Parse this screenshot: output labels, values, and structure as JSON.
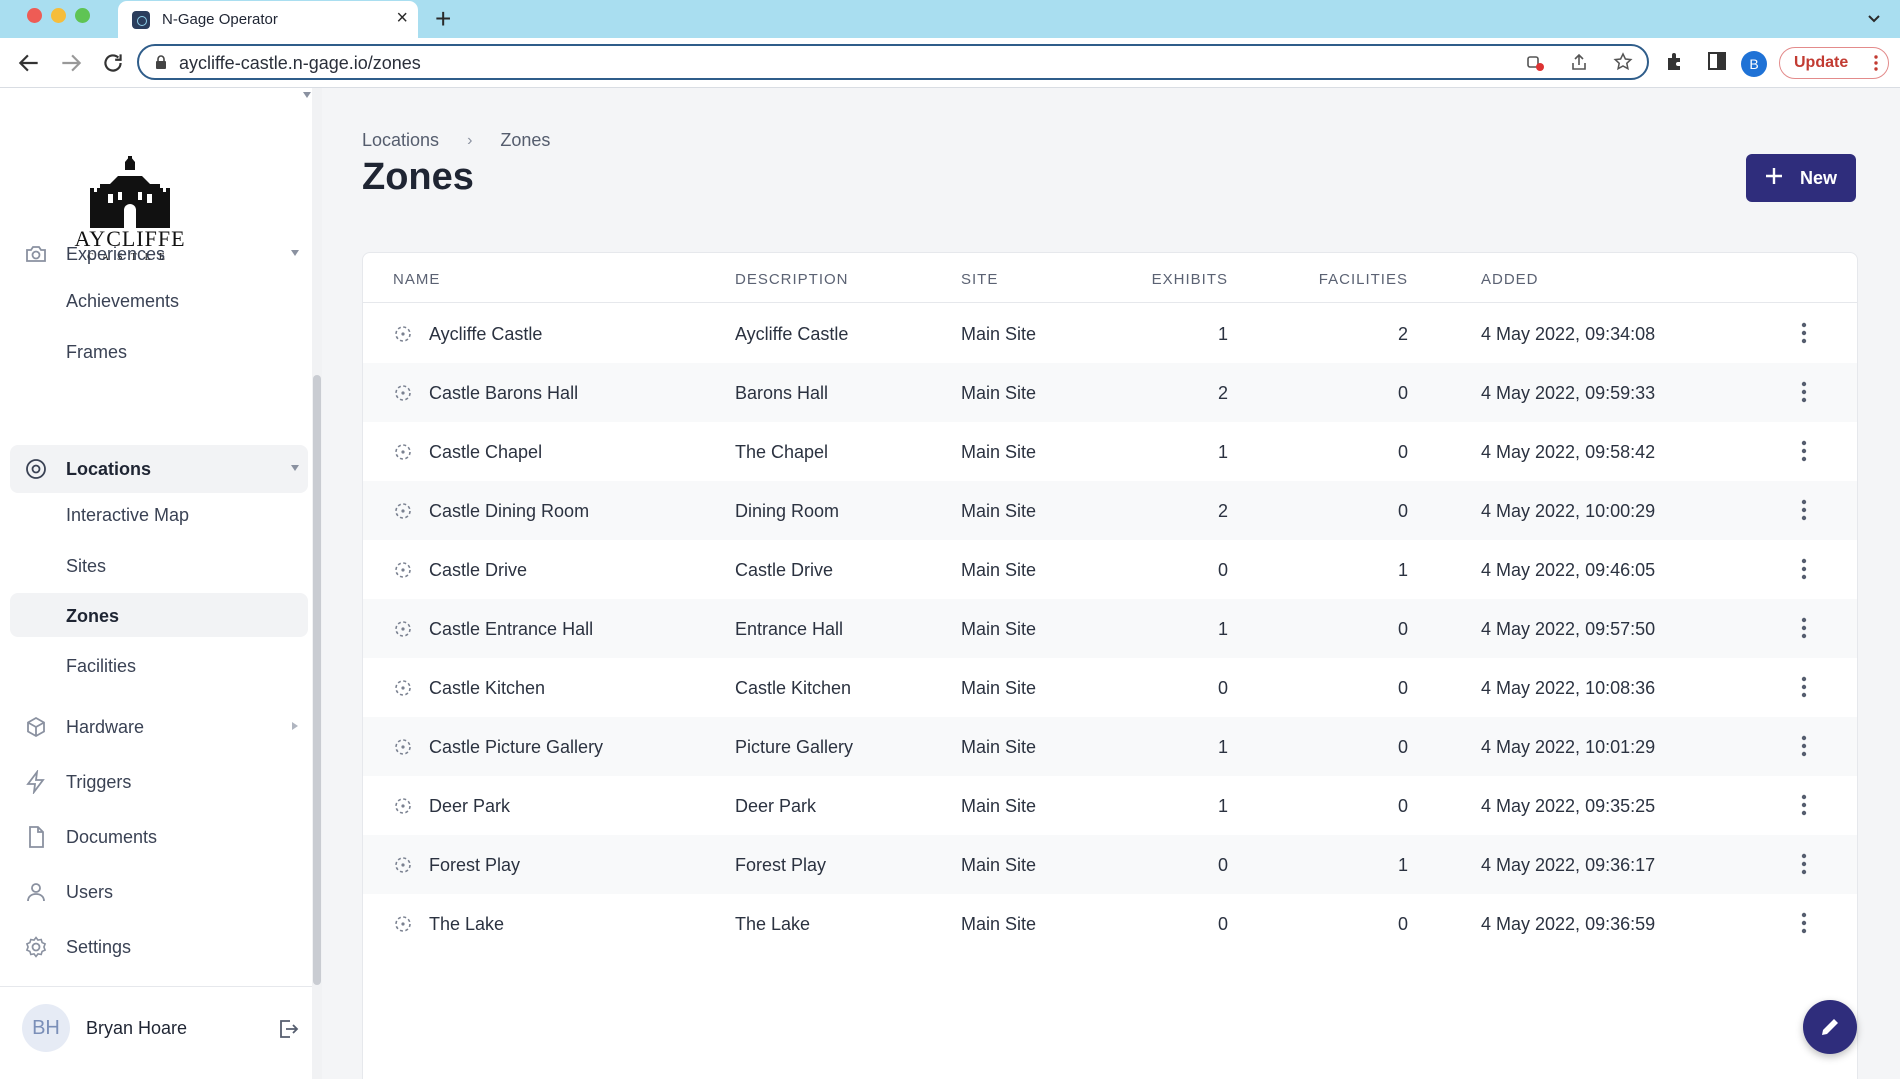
{
  "browser": {
    "tab_title": "N-Gage Operator",
    "tab_close": "×",
    "new_tab": "+",
    "url": "aycliffe-castle.n-gage.io/zones",
    "profile_initial": "B",
    "update_label": "Update"
  },
  "sidebar": {
    "logo": {
      "name": "AYCLIFFE",
      "sub": "CASTLE"
    },
    "items": [
      {
        "label": "Experiences",
        "icon": "camera-icon"
      },
      {
        "label": "Locations",
        "icon": "location-pin-icon"
      },
      {
        "label": "Hardware",
        "icon": "cube-icon"
      },
      {
        "label": "Triggers",
        "icon": "lightning-icon"
      },
      {
        "label": "Documents",
        "icon": "document-icon"
      },
      {
        "label": "Users",
        "icon": "user-icon"
      },
      {
        "label": "Settings",
        "icon": "gear-icon"
      }
    ],
    "experiences_sub": [
      "Achievements",
      "Frames"
    ],
    "locations_sub": [
      "Interactive Map",
      "Sites",
      "Zones",
      "Facilities"
    ],
    "user": {
      "initials": "BH",
      "name": "Bryan Hoare"
    }
  },
  "main": {
    "breadcrumb": {
      "parent": "Locations",
      "current": "Zones"
    },
    "title": "Zones",
    "new_label": "New",
    "columns": [
      "NAME",
      "DESCRIPTION",
      "SITE",
      "EXHIBITS",
      "FACILITIES",
      "ADDED"
    ],
    "rows": [
      {
        "name": "Aycliffe Castle",
        "description": "Aycliffe Castle",
        "site": "Main Site",
        "exhibits": "1",
        "facilities": "2",
        "added": "4 May 2022, 09:34:08"
      },
      {
        "name": "Castle Barons Hall",
        "description": "Barons Hall",
        "site": "Main Site",
        "exhibits": "2",
        "facilities": "0",
        "added": "4 May 2022, 09:59:33"
      },
      {
        "name": "Castle Chapel",
        "description": "The Chapel",
        "site": "Main Site",
        "exhibits": "1",
        "facilities": "0",
        "added": "4 May 2022, 09:58:42"
      },
      {
        "name": "Castle Dining Room",
        "description": "Dining Room",
        "site": "Main Site",
        "exhibits": "2",
        "facilities": "0",
        "added": "4 May 2022, 10:00:29"
      },
      {
        "name": "Castle Drive",
        "description": "Castle Drive",
        "site": "Main Site",
        "exhibits": "0",
        "facilities": "1",
        "added": "4 May 2022, 09:46:05"
      },
      {
        "name": "Castle Entrance Hall",
        "description": "Entrance Hall",
        "site": "Main Site",
        "exhibits": "1",
        "facilities": "0",
        "added": "4 May 2022, 09:57:50"
      },
      {
        "name": "Castle Kitchen",
        "description": "Castle Kitchen",
        "site": "Main Site",
        "exhibits": "0",
        "facilities": "0",
        "added": "4 May 2022, 10:08:36"
      },
      {
        "name": "Castle Picture Gallery",
        "description": "Picture Gallery",
        "site": "Main Site",
        "exhibits": "1",
        "facilities": "0",
        "added": "4 May 2022, 10:01:29"
      },
      {
        "name": "Deer Park",
        "description": "Deer Park",
        "site": "Main Site",
        "exhibits": "1",
        "facilities": "0",
        "added": "4 May 2022, 09:35:25"
      },
      {
        "name": "Forest Play",
        "description": "Forest Play",
        "site": "Main Site",
        "exhibits": "0",
        "facilities": "1",
        "added": "4 May 2022, 09:36:17"
      },
      {
        "name": "The Lake",
        "description": "The Lake",
        "site": "Main Site",
        "exhibits": "0",
        "facilities": "0",
        "added": "4 May 2022, 09:36:59"
      }
    ]
  },
  "colors": {
    "primary": "#2f2d7c",
    "tabbar": "#a9def0",
    "omnibox_border": "#2f5d8a",
    "update_text": "#c23b32"
  }
}
